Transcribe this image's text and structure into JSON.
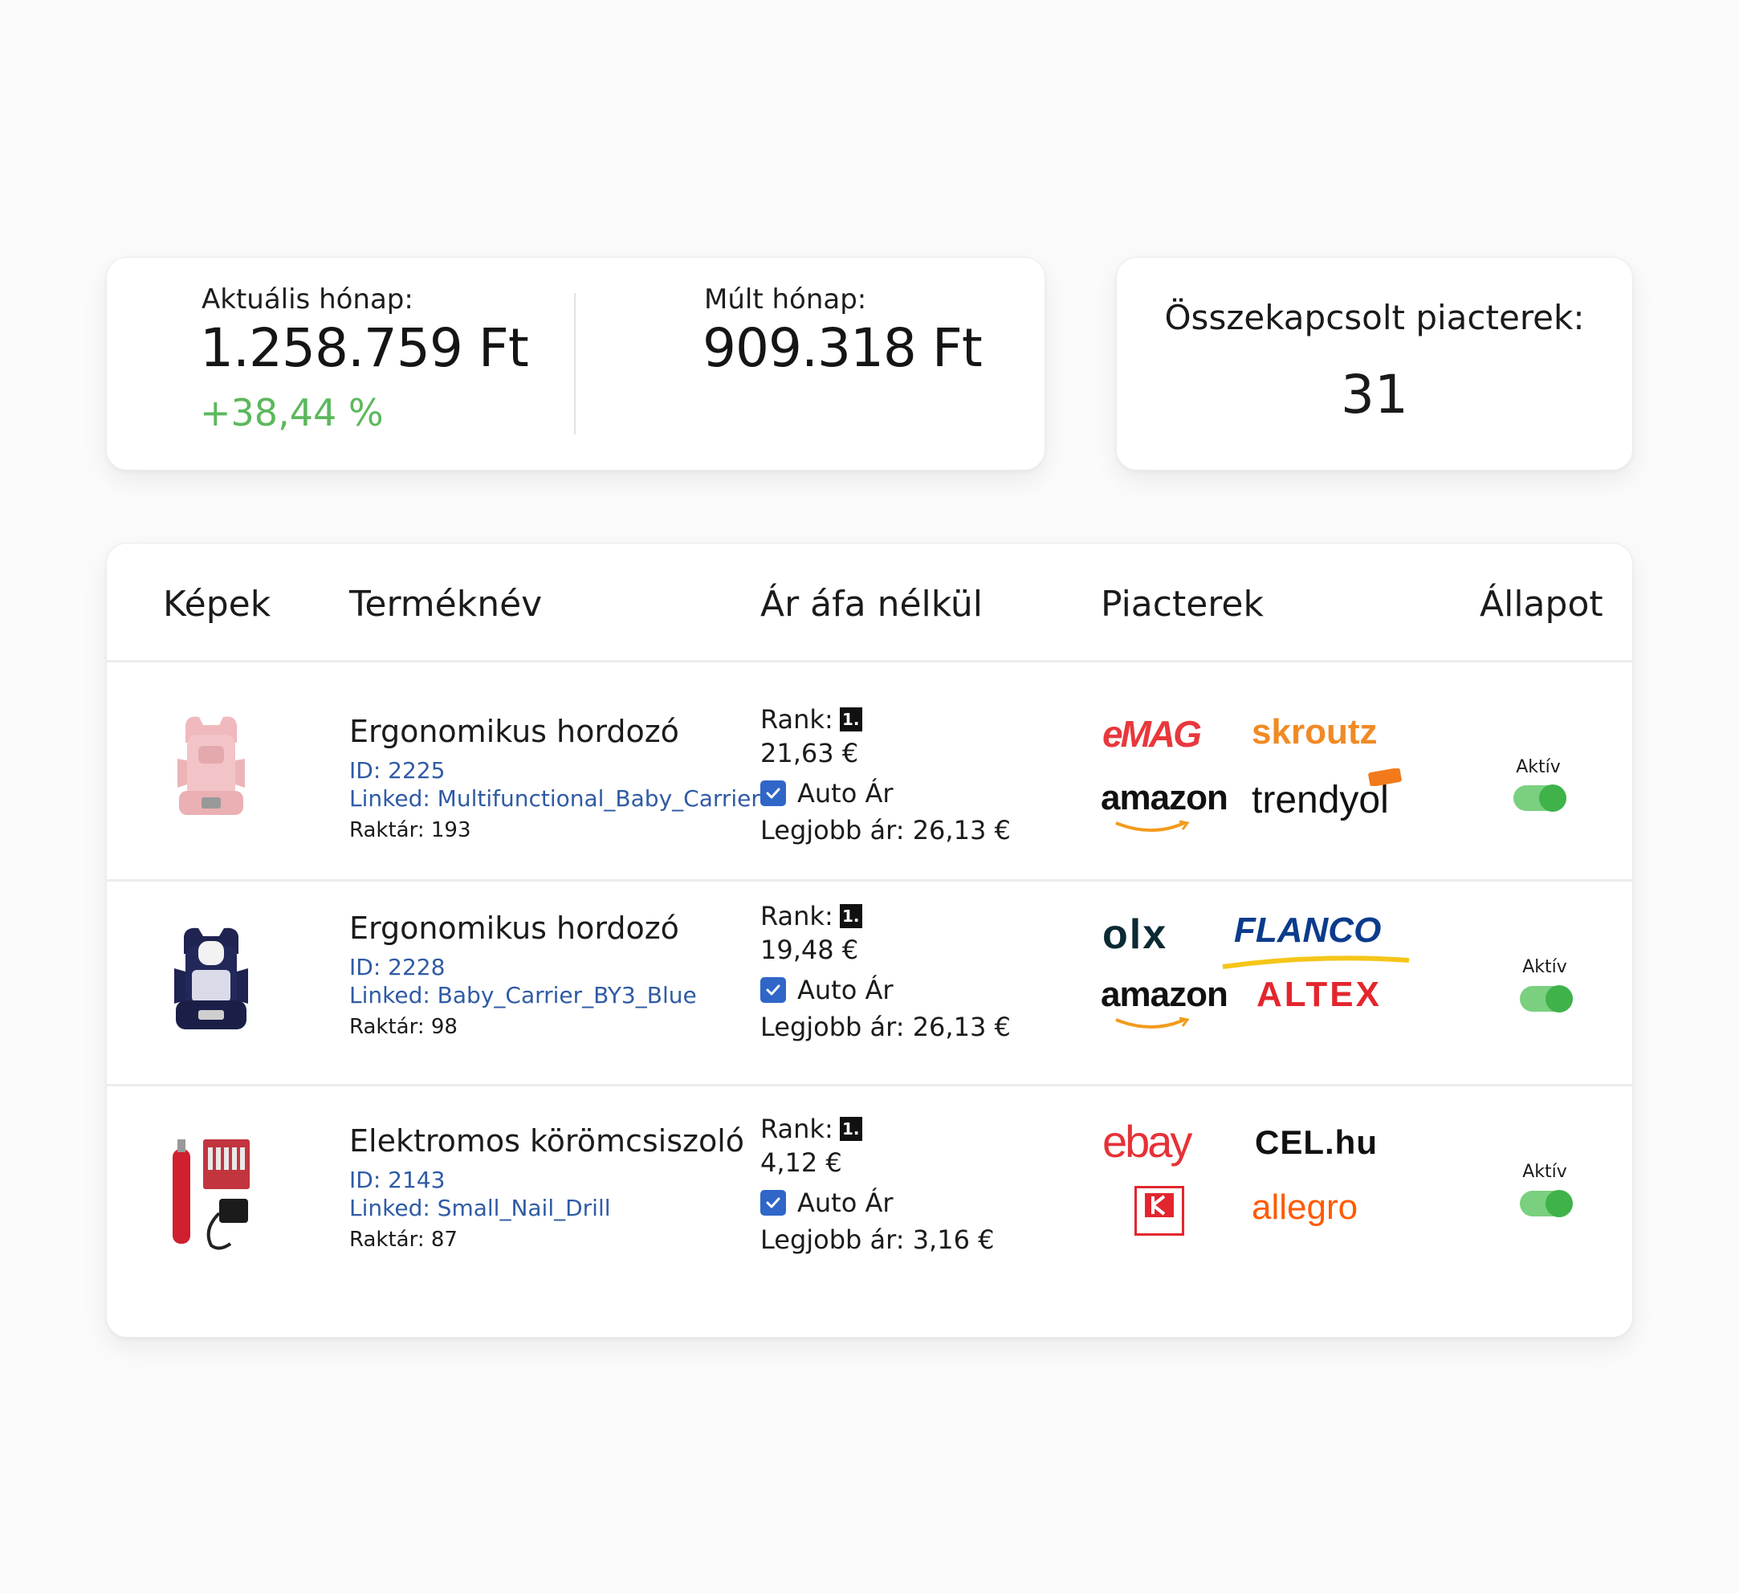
{
  "stats": {
    "current_label": "Aktuális hónap:",
    "current_value": "1.258.759 Ft",
    "change": "+38,44 %",
    "previous_label": "Múlt hónap:",
    "previous_value": "909.318 Ft",
    "change_color": "#5cb85c"
  },
  "markets": {
    "label": "Összekapcsolt piacterek:",
    "count": "31"
  },
  "table": {
    "headers": [
      "Képek",
      "Terméknév",
      "Ár áfa nélkül",
      "Piacterek",
      "Állapot"
    ],
    "rows": [
      {
        "name": "Ergonomikus hordozó",
        "id": "ID: 2225",
        "linked": "Linked: Multifunctional_Baby_Carrier",
        "stock": "Raktár: 193",
        "rank_label": "Rank:",
        "rank": "1.",
        "price": "21,63 €",
        "auto_price": "Auto Ár",
        "best_price": "Legjobb ár: 26,13 €",
        "marketplaces": [
          "eMAG",
          "skroutz",
          "amazon",
          "trendyol"
        ],
        "status": "Aktív",
        "image": "pink-baby-carrier"
      },
      {
        "name": "Ergonomikus hordozó",
        "id": "ID: 2228",
        "linked": "Linked: Baby_Carrier_BY3_Blue",
        "stock": "Raktár: 98",
        "rank_label": "Rank:",
        "rank": "1.",
        "price": "19,48 €",
        "auto_price": "Auto Ár",
        "best_price": "Legjobb ár: 26,13 €",
        "marketplaces": [
          "olx",
          "FLANCO",
          "amazon",
          "ALTEX"
        ],
        "status": "Aktív",
        "image": "navy-baby-carrier"
      },
      {
        "name": "Elektromos körömcsiszoló",
        "id": "ID: 2143",
        "linked": "Linked:  Small_Nail_Drill",
        "stock": "Raktár: 87",
        "rank_label": "Rank:",
        "rank": "1.",
        "price": "4,12 €",
        "auto_price": "Auto Ár",
        "best_price": "Legjobb ár: 3,16 €",
        "marketplaces": [
          "ebay",
          "CEL.hu",
          "Kaufland",
          "allegro"
        ],
        "status": "Aktív",
        "image": "red-nail-drill"
      }
    ]
  },
  "colors": {
    "link_blue": "#2f5ba4",
    "toggle_green": "#3fb24a",
    "checkbox_blue": "#2f66c8"
  }
}
